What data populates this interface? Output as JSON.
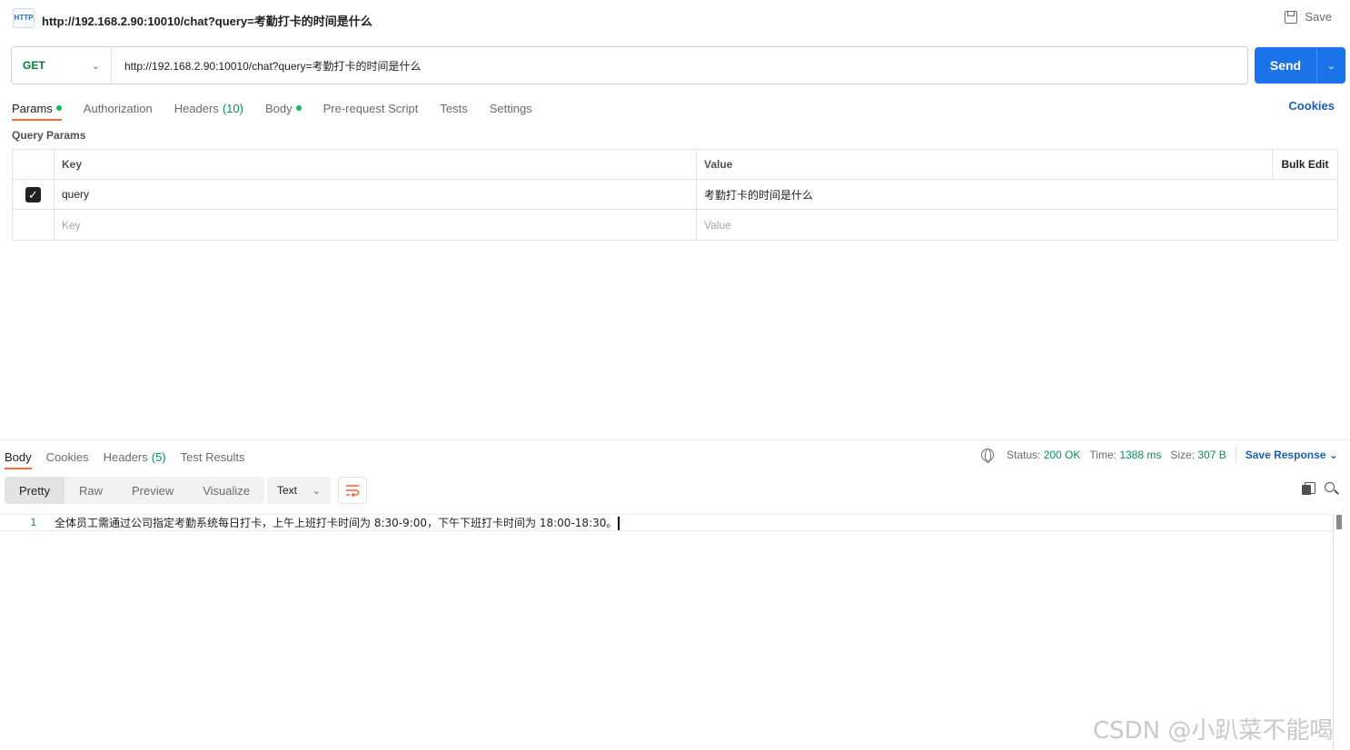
{
  "header": {
    "badge": "HTTP",
    "title": "http://192.168.2.90:10010/chat?query=考勤打卡的时间是什么",
    "save_label": "Save"
  },
  "request": {
    "method": "GET",
    "url": "http://192.168.2.90:10010/chat?query=考勤打卡的时间是什么",
    "send_label": "Send"
  },
  "req_tabs": [
    {
      "label": "Params",
      "dot": true
    },
    {
      "label": "Authorization"
    },
    {
      "label": "Headers",
      "count": "(10)"
    },
    {
      "label": "Body",
      "dot": true
    },
    {
      "label": "Pre-request Script"
    },
    {
      "label": "Tests"
    },
    {
      "label": "Settings"
    }
  ],
  "cookies_label": "Cookies",
  "query_params": {
    "section_label": "Query Params",
    "headers": {
      "key": "Key",
      "value": "Value",
      "bulk_edit": "Bulk Edit"
    },
    "rows": [
      {
        "checked": true,
        "key": "query",
        "value": "考勤打卡的时间是什么"
      }
    ],
    "placeholder": {
      "key": "Key",
      "value": "Value"
    }
  },
  "response": {
    "tabs": [
      {
        "label": "Body"
      },
      {
        "label": "Cookies"
      },
      {
        "label": "Headers",
        "count": "(5)"
      },
      {
        "label": "Test Results"
      }
    ],
    "status_label": "Status:",
    "status_value": "200 OK",
    "time_label": "Time:",
    "time_value": "1388 ms",
    "size_label": "Size:",
    "size_value": "307 B",
    "save_response": "Save Response",
    "formats": [
      "Pretty",
      "Raw",
      "Preview",
      "Visualize"
    ],
    "type": "Text",
    "line_number": "1",
    "body_text": "全体员工需通过公司指定考勤系统每日打卡，上午上班打卡时间为 8:30-9:00，下午下班打卡时间为 18:00-18:30。"
  },
  "watermark": "CSDN @小趴菜不能喝",
  "colors": {
    "accent": "#ff6c37",
    "send": "#1a73e8",
    "link": "#1a5fb4",
    "success": "#0a8f5a",
    "method_get": "#0a7d3b"
  }
}
